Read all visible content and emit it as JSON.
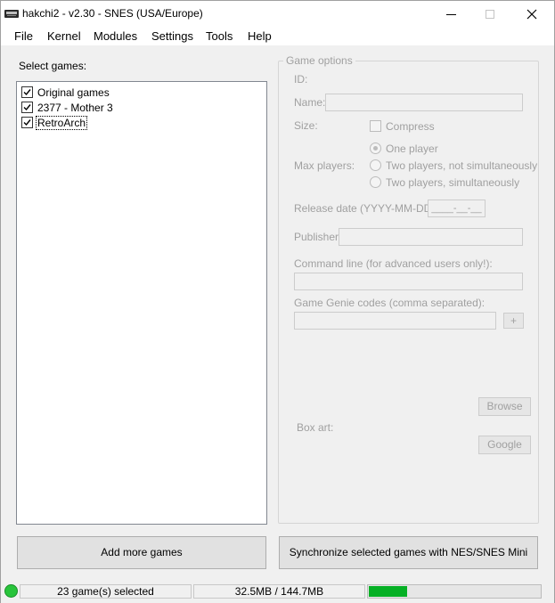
{
  "window": {
    "title": "hakchi2 - v2.30 - SNES (USA/Europe)",
    "minimize": "—",
    "maximize": "☐",
    "close": "✕"
  },
  "menu": {
    "items": [
      "File",
      "Kernel",
      "Modules",
      "Settings",
      "Tools",
      "Help"
    ]
  },
  "games": {
    "label": "Select games:",
    "items": [
      {
        "label": "Original games",
        "checked": true
      },
      {
        "label": "2377 - Mother 3",
        "checked": true
      },
      {
        "label": "RetroArch",
        "checked": true
      }
    ]
  },
  "options": {
    "group_title": "Game options",
    "id_label": "ID:",
    "name_label": "Name:",
    "size_label": "Size:",
    "compress_label": "Compress",
    "max_players_label": "Max players:",
    "players": [
      "One player",
      "Two players, not simultaneously",
      "Two players, simultaneously"
    ],
    "release_label": "Release date (YYYY-MM-DD):",
    "release_value": "____-__-__",
    "publisher_label": "Publisher:",
    "cmdline_label": "Command line (for advanced users only!):",
    "genie_label": "Game Genie codes (comma separated):",
    "genie_add": "+",
    "boxart_label": "Box art:",
    "browse_label": "Browse",
    "google_label": "Google"
  },
  "buttons": {
    "add_games": "Add more games",
    "sync": "Synchronize selected games with NES/SNES Mini"
  },
  "status": {
    "indicator_color": "#28c43b",
    "selected_text": "23 game(s) selected",
    "size_text": "32.5MB / 144.7MB",
    "progress_fraction": 0.2246
  }
}
